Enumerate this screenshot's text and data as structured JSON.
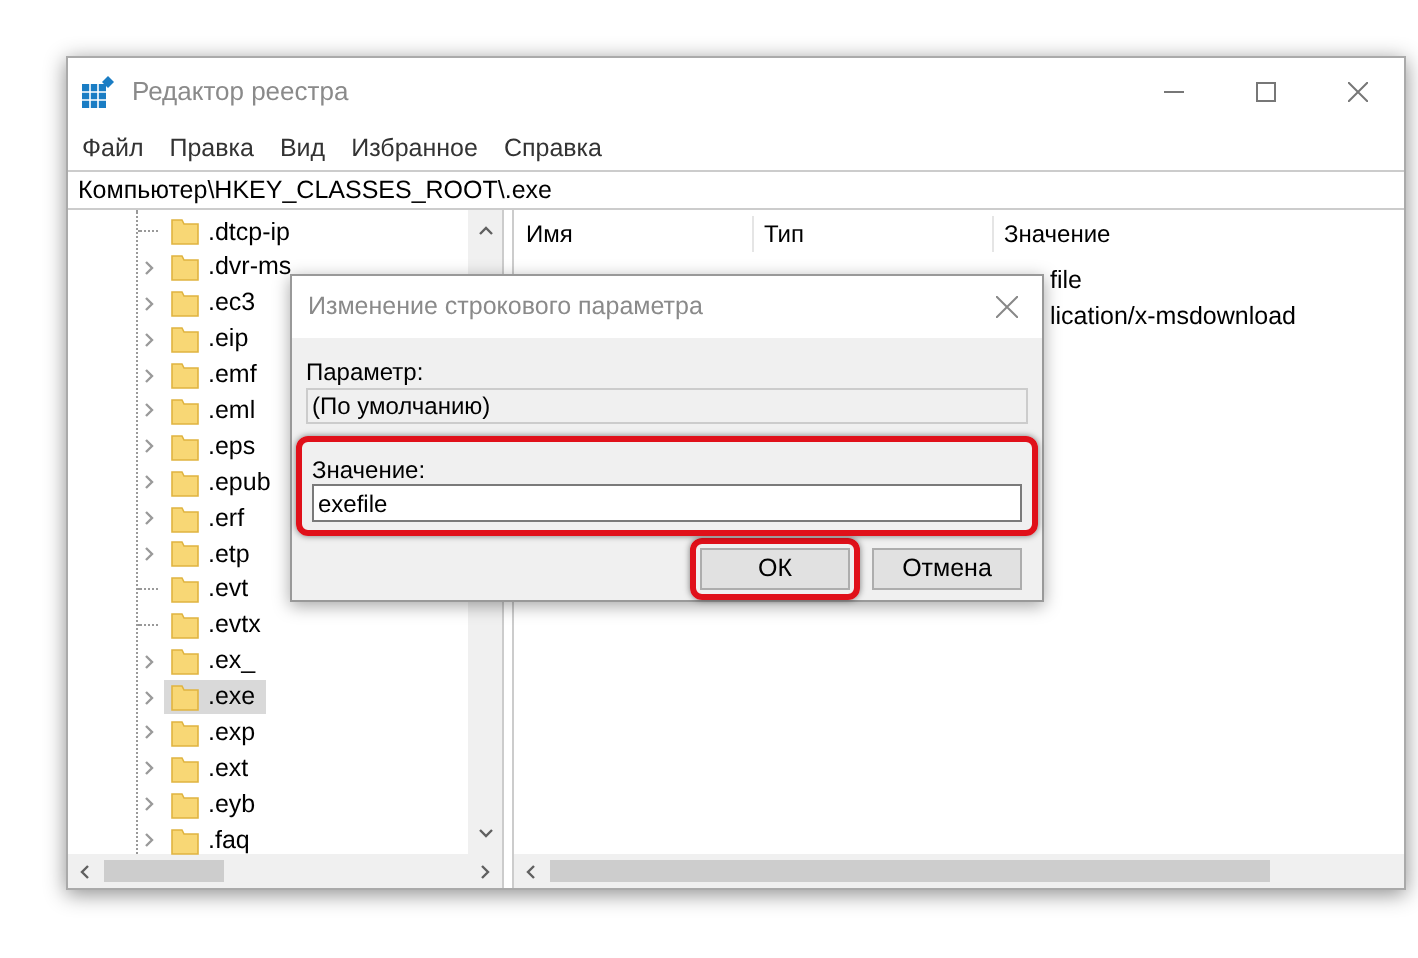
{
  "window": {
    "title": "Редактор реестра"
  },
  "menu": [
    "Файл",
    "Правка",
    "Вид",
    "Избранное",
    "Справка"
  ],
  "address": "Компьютер\\HKEY_CLASSES_ROOT\\.exe",
  "tree": [
    {
      "label": ".dtcp-ip",
      "kind": "leaf",
      "selected": false
    },
    {
      "label": ".dvr-ms",
      "kind": "branch",
      "selected": false
    },
    {
      "label": ".ec3",
      "kind": "branch",
      "selected": false
    },
    {
      "label": ".eip",
      "kind": "branch",
      "selected": false
    },
    {
      "label": ".emf",
      "kind": "branch",
      "selected": false
    },
    {
      "label": ".eml",
      "kind": "branch",
      "selected": false
    },
    {
      "label": ".eps",
      "kind": "branch",
      "selected": false
    },
    {
      "label": ".epub",
      "kind": "branch",
      "selected": false
    },
    {
      "label": ".erf",
      "kind": "branch",
      "selected": false
    },
    {
      "label": ".etp",
      "kind": "branch",
      "selected": false
    },
    {
      "label": ".evt",
      "kind": "leaf",
      "selected": false
    },
    {
      "label": ".evtx",
      "kind": "leaf",
      "selected": false
    },
    {
      "label": ".ex_",
      "kind": "branch",
      "selected": false
    },
    {
      "label": ".exe",
      "kind": "branch",
      "selected": true
    },
    {
      "label": ".exp",
      "kind": "branch",
      "selected": false
    },
    {
      "label": ".ext",
      "kind": "branch",
      "selected": false
    },
    {
      "label": ".eyb",
      "kind": "branch",
      "selected": false
    },
    {
      "label": ".faq",
      "kind": "branch",
      "selected": false
    }
  ],
  "columns": [
    "Имя",
    "Тип",
    "Значение"
  ],
  "rows": [
    {
      "value": "file"
    },
    {
      "value": "lication/x-msdownload"
    }
  ],
  "dialog": {
    "title": "Изменение строкового параметра",
    "name_label": "Параметр:",
    "name_value": "(По умолчанию)",
    "value_label": "Значение:",
    "value": "exefile",
    "value_highlighted": true,
    "buttons": [
      {
        "label": "ОК",
        "highlighted": true
      },
      {
        "label": "Отмена",
        "highlighted": false
      }
    ]
  }
}
